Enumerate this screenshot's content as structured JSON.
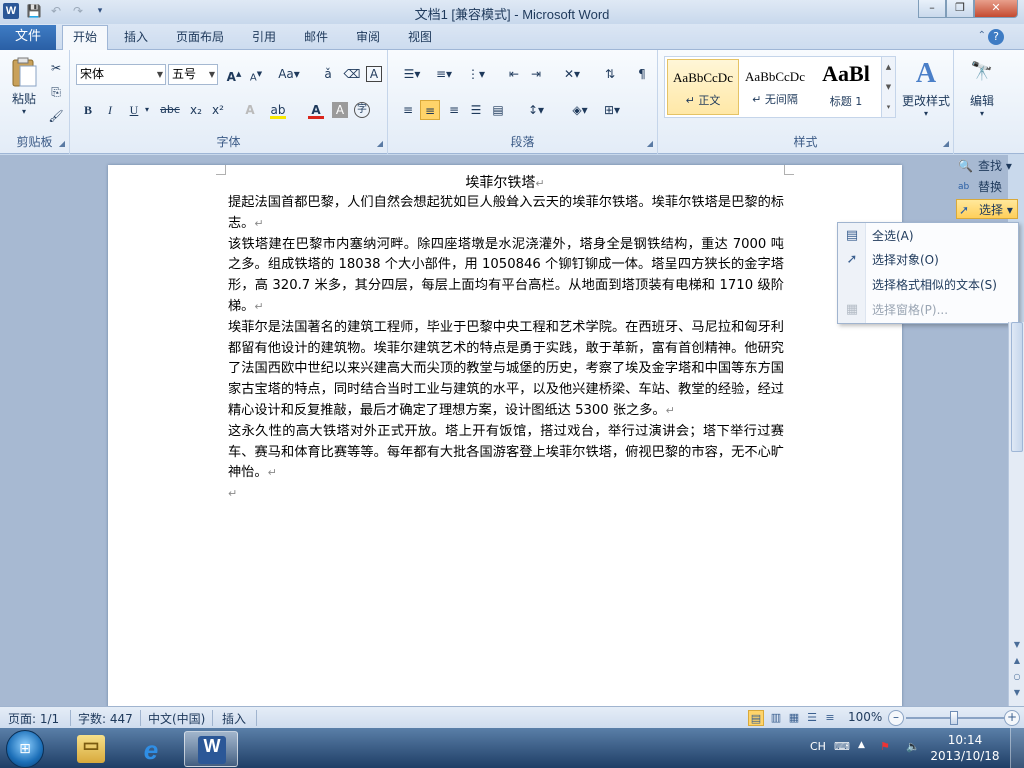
{
  "titlebar": {
    "title": "文档1 [兼容模式] - Microsoft Word",
    "app_icon": "W",
    "qat_icons": [
      "save-icon",
      "undo-icon",
      "redo-icon",
      "customize-qat-icon"
    ]
  },
  "tabs": {
    "file": "文件",
    "items": [
      "开始",
      "插入",
      "页面布局",
      "引用",
      "邮件",
      "审阅",
      "视图"
    ],
    "active": "开始"
  },
  "clipboard": {
    "paste": "粘贴",
    "label": "剪贴板"
  },
  "font": {
    "name": "宋体",
    "size": "五号",
    "label": "字体",
    "bold": "B",
    "italic": "I",
    "underline": "U",
    "strike": "abc",
    "subscript": "x₂",
    "superscript": "x²",
    "grow": "A",
    "shrink": "A",
    "change_case": "Aa",
    "font_color": "A",
    "char_shade": "A",
    "clear": "A"
  },
  "paragraph": {
    "label": "段落"
  },
  "styles": {
    "label": "样式",
    "tiles": [
      {
        "sample": "AaBbCcDc",
        "name": "正文",
        "selected": true
      },
      {
        "sample": "AaBbCcDc",
        "name": "无间隔",
        "selected": false
      },
      {
        "sample": "AaBl",
        "name": "标题 1",
        "selected": false
      }
    ],
    "change_styles": "更改样式"
  },
  "editing": {
    "label": "编辑",
    "find": "查找",
    "replace": "替换",
    "select": "选择"
  },
  "select_menu": {
    "items": [
      {
        "label": "全选(A)",
        "icon": "select-all-icon",
        "disabled": false
      },
      {
        "label": "选择对象(O)",
        "icon": "cursor-icon",
        "disabled": false
      },
      {
        "label": "选择格式相似的文本(S)",
        "icon": "",
        "disabled": false
      },
      {
        "label": "选择窗格(P)...",
        "icon": "selection-pane-icon",
        "disabled": true
      }
    ]
  },
  "document": {
    "title": "埃菲尔铁塔",
    "paragraphs": [
      "提起法国首都巴黎，人们自然会想起犹如巨人般耸入云天的埃菲尔铁塔。埃菲尔铁塔是巴黎的标志。",
      "该铁塔建在巴黎市内塞纳河畔。除四座塔墩是水泥浇灌外，塔身全是钢铁结构，重达 7000 吨之多。组成铁塔的 18038 个大小部件，用 1050846 个铆钉铆成一体。塔呈四方狭长的金字塔形，高 320.7 米多，其分四层，每层上面均有平台高栏。从地面到塔顶装有电梯和 1710 级阶梯。",
      "埃菲尔是法国著名的建筑工程师，毕业于巴黎中央工程和艺术学院。在西班牙、马尼拉和匈牙利都留有他设计的建筑物。埃菲尔建筑艺术的特点是勇于实践，敢于革新，富有首创精神。他研究了法国西欧中世纪以来兴建高大而尖顶的教堂与城堡的历史，考察了埃及金字塔和中国等东方国家古宝塔的特点，同时结合当时工业与建筑的水平，以及他兴建桥梁、车站、教堂的经验，经过精心设计和反复推敲，最后才确定了理想方案，设计图纸达 5300 张之多。",
      "这永久性的高大铁塔对外正式开放。塔上开有饭馆，搭过戏台，举行过演讲会；塔下举行过赛车、赛马和体育比赛等等。每年都有大批各国游客登上埃菲尔铁塔，俯视巴黎的市容，无不心旷神怡。"
    ],
    "para_mark": "↵"
  },
  "statusbar": {
    "page": "页面: 1/1",
    "words": "字数: 447",
    "language": "中文(中国)",
    "mode": "插入",
    "zoom": "100%",
    "zoom_level": 1.0
  },
  "taskbar": {
    "apps": [
      "explorer",
      "internet-explorer",
      "word"
    ],
    "active_app": "word",
    "ime": "CH",
    "time": "10:14",
    "date": "2013/10/18"
  },
  "colors": {
    "file_tab": "#2a5fa5",
    "highlight": "#ffcf5a",
    "font_color_bar": "#d9261c",
    "highlight_bar": "#f7e700"
  }
}
